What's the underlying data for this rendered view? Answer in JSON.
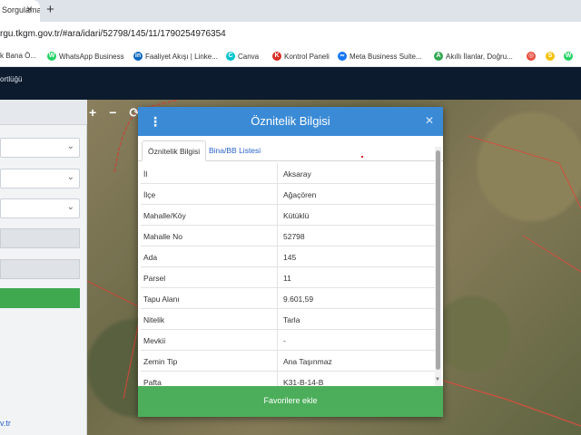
{
  "browser": {
    "tab_title": "Sorgulama",
    "tab_close": "×",
    "new_tab": "+",
    "url": "rgu.tkgm.gov.tr/#ara/idari/52798/145/11/1790254976354"
  },
  "bookmarks": [
    {
      "label": "k Bana Ö...",
      "icon": "bookmark-icon",
      "color": "#555555",
      "glyph": ""
    },
    {
      "label": "WhatsApp Business",
      "icon": "whatsapp-icon",
      "color": "#25d366",
      "glyph": "W"
    },
    {
      "label": "Faaliyet Akışı | Linke...",
      "icon": "linkedin-icon",
      "color": "#0a66c2",
      "glyph": "in"
    },
    {
      "label": "Canva",
      "icon": "canva-icon",
      "color": "#00c4cc",
      "glyph": "C"
    },
    {
      "label": "Kontrol Paneli",
      "icon": "shield-icon",
      "color": "#d93025",
      "glyph": "K"
    },
    {
      "label": "Meta Business Suite...",
      "icon": "meta-icon",
      "color": "#1877f2",
      "glyph": "∞"
    },
    {
      "label": "Akıllı İlanlar, Doğru...",
      "icon": "leaf-icon",
      "color": "#34a853",
      "glyph": "A"
    },
    {
      "label": "",
      "icon": "ring-icon",
      "color": "#e84c3d",
      "glyph": "◎"
    },
    {
      "label": "",
      "icon": "s-icon",
      "color": "#f4c20d",
      "glyph": "S"
    },
    {
      "label": "",
      "icon": "whatsapp-icon",
      "color": "#25d366",
      "glyph": "W"
    }
  ],
  "app_header": {
    "text": "ortlüğü"
  },
  "left_panel": {
    "link": "v.tr"
  },
  "map": {
    "zoom_in": "+",
    "zoom_out": "−",
    "refresh": "⟳"
  },
  "dialog": {
    "title": "Öznitelik Bilgisi",
    "menu_icon": "⋮",
    "close_icon": "✕",
    "tabs": [
      "Öznitelik Bilgisi",
      "Bina/BB Listesi"
    ],
    "rows": [
      {
        "key": "İl",
        "value": "Aksaray"
      },
      {
        "key": "İlçe",
        "value": "Ağaçören"
      },
      {
        "key": "Mahalle/Köy",
        "value": "Kütüklü"
      },
      {
        "key": "Mahalle No",
        "value": "52798"
      },
      {
        "key": "Ada",
        "value": "145"
      },
      {
        "key": "Parsel",
        "value": "11"
      },
      {
        "key": "Tapu Alanı",
        "value": "9.601,59"
      },
      {
        "key": "Nitelik",
        "value": "Tarla"
      },
      {
        "key": "Mevkii",
        "value": "-"
      },
      {
        "key": "Zemin Tip",
        "value": "Ana Taşınmaz"
      },
      {
        "key": "Pafta",
        "value": "K31-B-14-B"
      }
    ],
    "favorite_button": "Favorilere ekle"
  },
  "colors": {
    "header_blue": "#3a8ad6",
    "favorite_green": "#4cae5a",
    "app_header": "#0d1b2e"
  }
}
